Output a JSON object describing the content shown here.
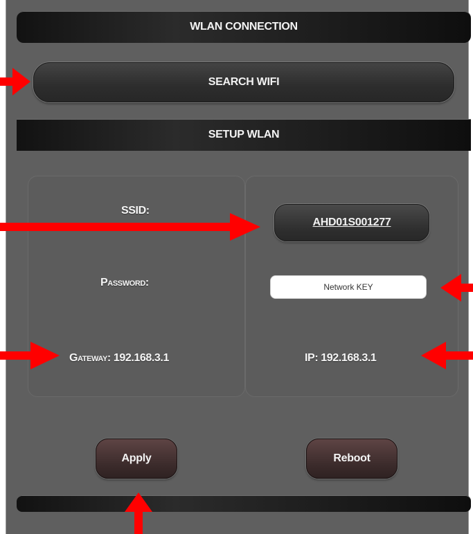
{
  "header": {
    "title": "WLAN CONNECTION"
  },
  "search": {
    "label": "SEARCH WIFI"
  },
  "setup": {
    "title": "SETUP WLAN"
  },
  "form": {
    "ssid_label": "SSID:",
    "ssid_value": "AHD01S001277",
    "password_label": "Password:",
    "password_placeholder": "Network KEY",
    "gateway_text": "Gateway: 192.168.3.1",
    "ip_text": "IP: 192.168.3.1"
  },
  "actions": {
    "apply_label": "Apply",
    "reboot_label": "Reboot"
  },
  "colors": {
    "arrow": "#ff0000",
    "panel": "#5f5f5f",
    "bar": "#1c1c1c"
  },
  "annotations": {
    "arrow_icon": "red-arrow-icon"
  }
}
